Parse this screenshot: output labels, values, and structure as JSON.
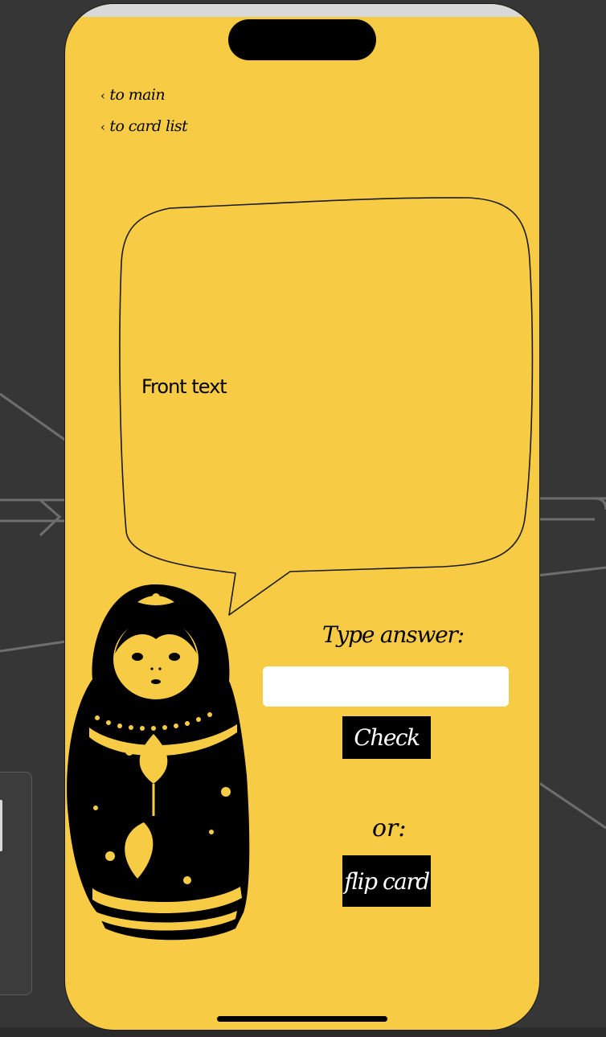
{
  "nav": {
    "to_main": "to main",
    "to_card_list": "to card list",
    "chevron": "‹"
  },
  "card": {
    "front_text": "Front text"
  },
  "answer": {
    "prompt": "Type answer:",
    "input_value": "",
    "input_placeholder": "",
    "check_label": "Check"
  },
  "alternative": {
    "or_label": "or:",
    "flip_label": "flip card"
  },
  "icons": [
    "chevron-left-icon",
    "matryoshka-doll-illustration"
  ],
  "colors": {
    "screen_background": "#f7cc44",
    "button_background": "#000000",
    "button_text": "#ffffff",
    "outer_background": "#363636"
  }
}
